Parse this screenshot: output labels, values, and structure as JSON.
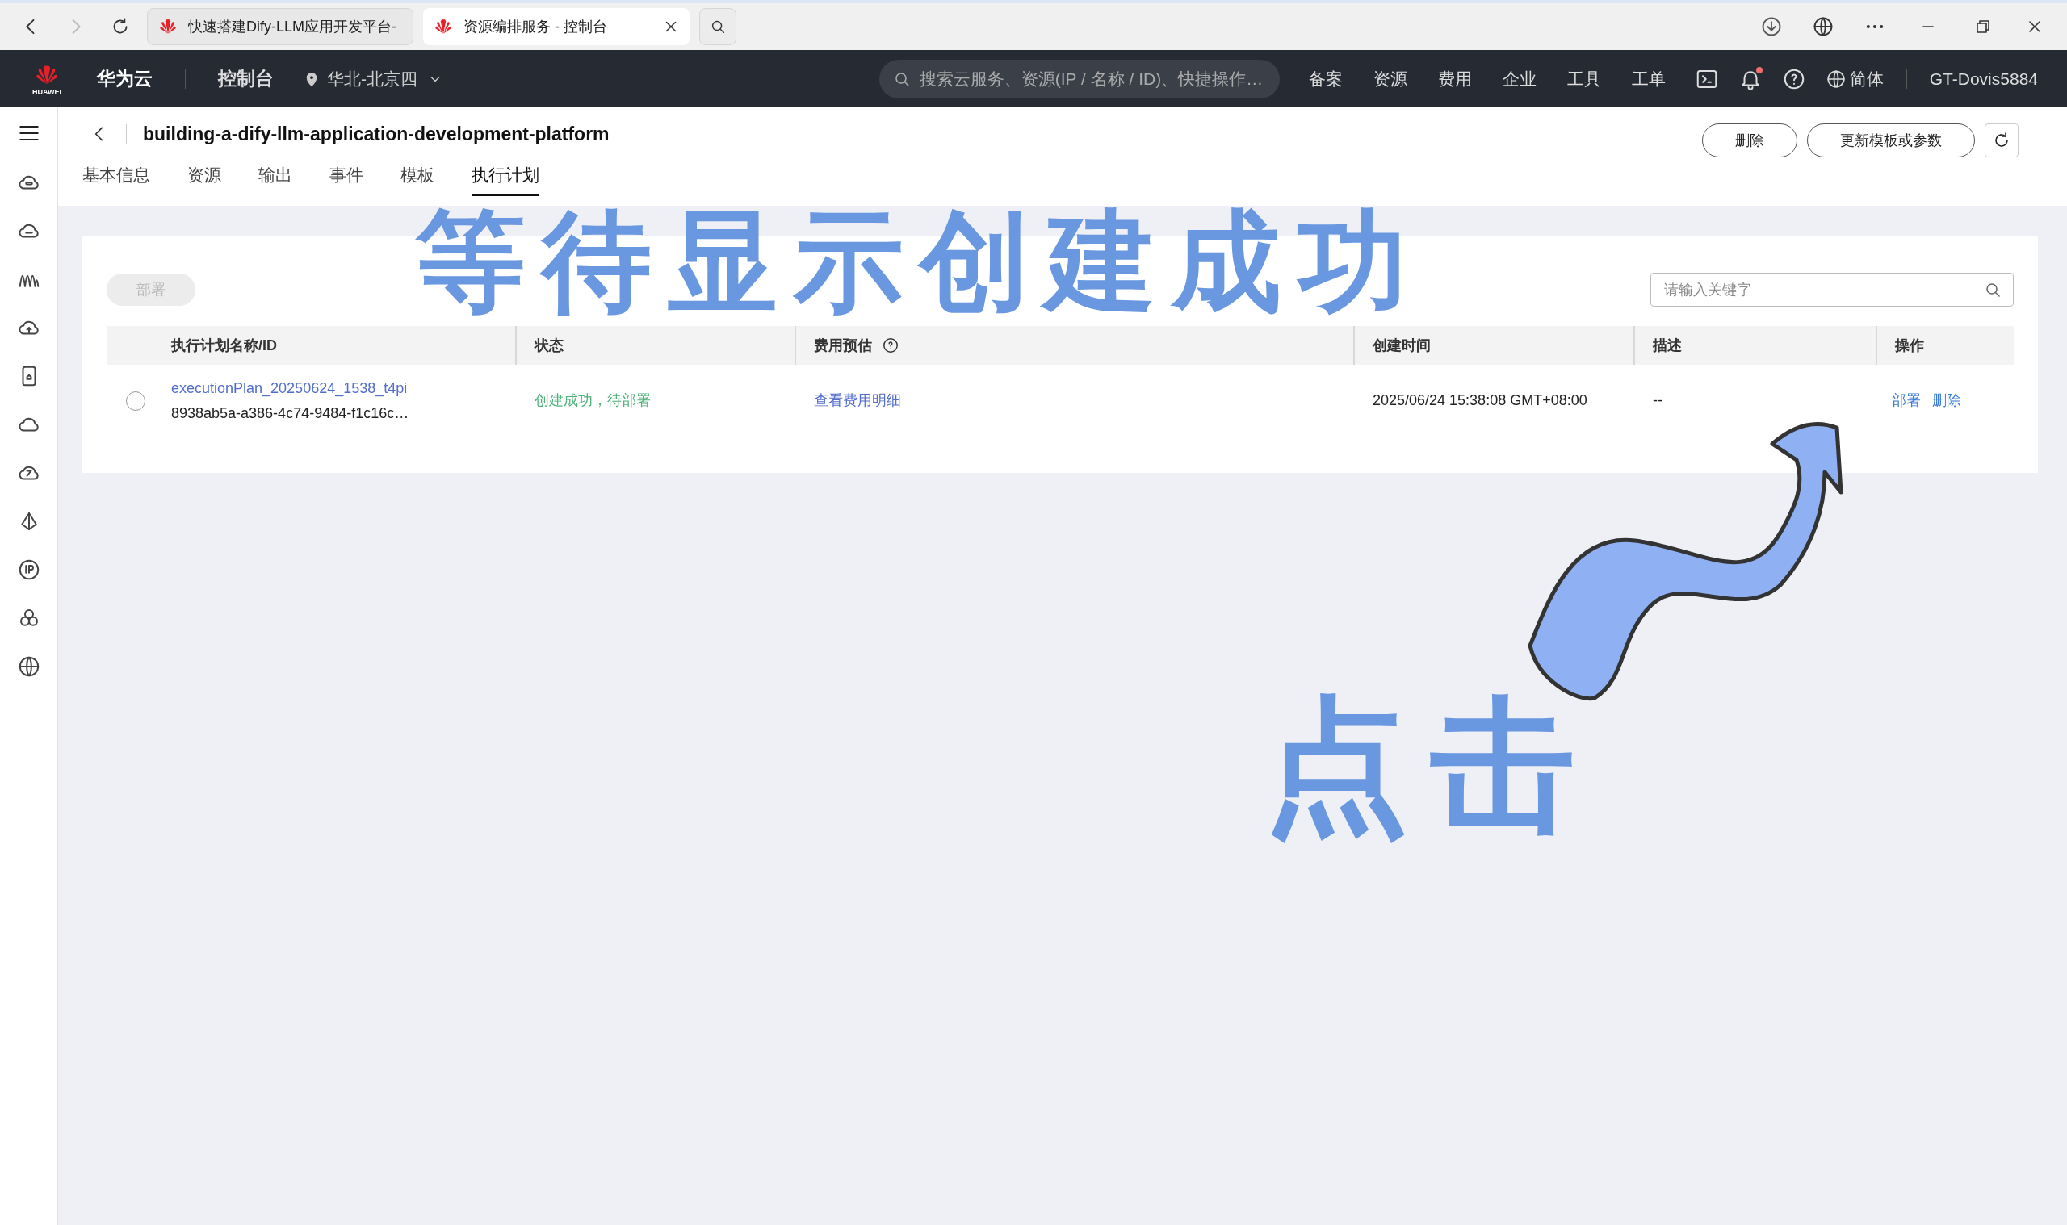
{
  "browser": {
    "tabs": [
      {
        "title": "快速搭建Dify-LLM应用开发平台-",
        "selected": false
      },
      {
        "title": "资源编排服务 - 控制台",
        "selected": true
      }
    ]
  },
  "topbar": {
    "brand": "华为云",
    "logo_caption": "HUAWEI",
    "console": "控制台",
    "region": "华北-北京四",
    "search_placeholder": "搜索云服务、资源(IP / 名称 / ID)、快捷操作…",
    "links": [
      "备案",
      "资源",
      "费用",
      "企业",
      "工具",
      "工单"
    ],
    "language": "简体",
    "user": "GT-Dovis5884"
  },
  "page": {
    "title": "building-a-dify-llm-application-development-platform",
    "buttons": [
      "删除",
      "更新模板或参数"
    ],
    "tabs": [
      {
        "label": "基本信息",
        "selected": false
      },
      {
        "label": "资源",
        "selected": false
      },
      {
        "label": "输出",
        "selected": false
      },
      {
        "label": "事件",
        "selected": false
      },
      {
        "label": "模板",
        "selected": false
      },
      {
        "label": "执行计划",
        "selected": true
      }
    ]
  },
  "toolbar": {
    "deploy_button": {
      "label": "部署",
      "disabled": true
    },
    "search_placeholder": "请输入关键字"
  },
  "table": {
    "columns": [
      "执行计划名称/ID",
      "状态",
      "费用预估",
      "创建时间",
      "描述",
      "操作"
    ],
    "rows": [
      {
        "selected": false,
        "name": "executionPlan_20250624_1538_t4pi",
        "id": "8938ab5a-a386-4c74-9484-f1c16c…",
        "status": "创建成功，待部署",
        "cost": "查看费用明细",
        "created": "2025/06/24 15:38:08 GMT+08:00",
        "description": "--",
        "actions": [
          "部署",
          "删除"
        ]
      }
    ]
  },
  "annotations": [
    "等待显示创建成功",
    "点击"
  ]
}
